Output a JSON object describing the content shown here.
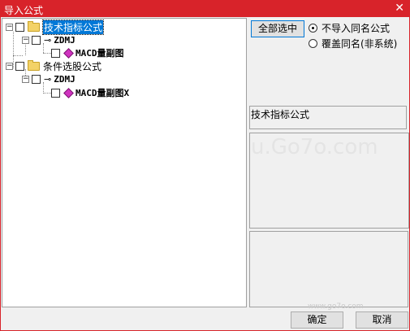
{
  "window": {
    "title": "导入公式",
    "close_glyph": "✕"
  },
  "tree": {
    "groups": [
      {
        "label": "技术指标公式",
        "expander": "−",
        "child": {
          "label": "ZDMJ",
          "expander": "−",
          "leaf": "MACD量副图"
        }
      },
      {
        "label": "条件选股公式",
        "expander": "−",
        "child": {
          "label": "ZDMJ",
          "expander": "−",
          "leaf": "MACD量副图X"
        }
      }
    ]
  },
  "buttons": {
    "select_all": "全部选中",
    "ok": "确定",
    "cancel": "取消"
  },
  "options": [
    {
      "label": "不导入同名公式",
      "checked": true
    },
    {
      "label": "覆盖同名(非系统)",
      "checked": false
    }
  ],
  "formula_type_text": "技术指标公式",
  "watermarks": {
    "main": "u.Go7o.com",
    "footer": "www.go7o.com"
  },
  "colors": {
    "titlebar": "#d8232a",
    "selection": "#0078d7"
  },
  "icons": [
    "folder-icon",
    "key-icon",
    "formula-gem-icon",
    "close-icon"
  ]
}
